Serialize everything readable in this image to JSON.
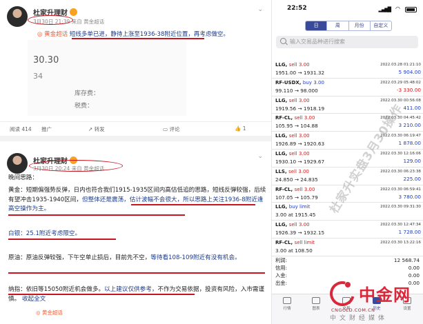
{
  "weibo": {
    "post1": {
      "username": "杜家升理财",
      "time": "3月30日 21:39",
      "source": "来自 黄金超话",
      "reply_tag": "黄金超话",
      "reply_text": "短线多单已进，静待上涨至1936-38附近位置，再考虑做空。",
      "quote_big": "30.30",
      "quote_small": "34",
      "quote_rows": [
        "库存费：",
        "税费："
      ],
      "actions": [
        "阅读 414",
        "推广",
        "转发",
        "评论",
        "1"
      ]
    },
    "post2": {
      "username": "杜家升理财",
      "time": "3月30日 20:24",
      "source": "来自 黄金超话",
      "title": "晚间思路：",
      "para_gold_1": "黄金：短期偏强势反弹，日内也符合我们1915-1935区间内高估低追的思路，短线反弹较强，后续有望冲击1935-1940区间，",
      "para_gold_hl": "但整体还是震荡，估计波幅不会很大，所以思路上关注1936-8附近逢高空操作为主。",
      "silver": "白银：25.1附近考虑限空。",
      "oil_1": "原油：原油反弹较强，下午空单止损后，目前先不空，",
      "oil_hl": "等待看108-109附近有没有机会。",
      "nasdaq_1": "纳指：依旧等15050附近机会做多。",
      "nasdaq_hl": "以上建议仅供参考，",
      "nasdaq_2": "不作为交易依据，投资有风险，入市需谨慎。",
      "collapse": "收起全文",
      "footer_tag": "黄金超话"
    }
  },
  "app": {
    "status_time": "22:52",
    "segments": [
      "日",
      "周",
      "月份",
      "自定义"
    ],
    "search_placeholder": "输入交易品种进行搜索",
    "orders": [
      {
        "sym": "LLG,",
        "act": "sell",
        "qty": "3.00",
        "date": "2022.03.28 01:21:10",
        "price": "1951.00 → 1931.32",
        "pl": "5 904.00",
        "neg": false
      },
      {
        "sym": "RF-USDX,",
        "act": "buy",
        "qty": "3.00",
        "date": "2022.03.29 05:48:02",
        "price": "99.110 → 98.000",
        "pl": "-3 330.00",
        "neg": true
      },
      {
        "sym": "LLG,",
        "act": "sell",
        "qty": "3.00",
        "date": "2022.03.30 00:56:08",
        "price": "1919.56 → 1918.19",
        "pl": "411.00",
        "neg": false
      },
      {
        "sym": "RF-CL,",
        "act": "sell",
        "qty": "3.00",
        "date": "2022.03.30 04:45:42",
        "price": "105.95 → 104.88",
        "pl": "3 210.00",
        "neg": false
      },
      {
        "sym": "LLG,",
        "act": "sell",
        "qty": "3.00",
        "date": "2022.03.30 06:19:47",
        "price": "1926.89 → 1920.63",
        "pl": "1 878.00",
        "neg": false
      },
      {
        "sym": "LLG,",
        "act": "sell",
        "qty": "3.00",
        "date": "2022.03.30 12:16:06",
        "price": "1930.10 → 1929.67",
        "pl": "129.00",
        "neg": false
      },
      {
        "sym": "LLS,",
        "act": "sell",
        "qty": "3.00",
        "date": "2022.03.30 06:23:38",
        "price": "24.850 → 24.835",
        "pl": "225.00",
        "neg": false
      },
      {
        "sym": "RF-CL,",
        "act": "sell",
        "qty": "3.00",
        "date": "2022.03.30 06:59:41",
        "price": "107.05 → 105.79",
        "pl": "3 780.00",
        "neg": false
      },
      {
        "sym": "LLG,",
        "act": "buy limit",
        "qty": "",
        "date": "2022.03.30 09:31:30",
        "price": "3.00 at 1915.45",
        "pl": "",
        "neg": false
      },
      {
        "sym": "LLG,",
        "act": "sell",
        "qty": "3.00",
        "date": "2022.03.30 12:47:34",
        "price": "1926.39 → 1932.15",
        "pl": "1 728.00",
        "neg": false
      },
      {
        "sym": "RF-CL,",
        "act": "sell limit",
        "qty": "",
        "date": "2022.03.30 13:22:16",
        "price": "3.00 at 108.50",
        "pl": "",
        "neg": false
      }
    ],
    "summary": [
      {
        "label": "利润:",
        "value": "12 568.74"
      },
      {
        "label": "信用:",
        "value": "0.00"
      },
      {
        "label": "入金:",
        "value": "0.00"
      },
      {
        "label": "出金:",
        "value": "0.00"
      }
    ],
    "tabs": [
      "行情",
      "图表",
      "交易",
      "历史",
      "设置"
    ]
  },
  "watermark": "杜家升实盘3月30操作",
  "logo": {
    "name": "中金网",
    "url": "CNGOLD.COM.CN",
    "sub": "中文财经媒体"
  },
  "colors": {
    "accent": "#3a4a9a",
    "annotation_red": "#c8141e",
    "sell_red": "#d21d1d",
    "buy_blue": "#1e3cc8",
    "logo_red": "#d8283a"
  }
}
